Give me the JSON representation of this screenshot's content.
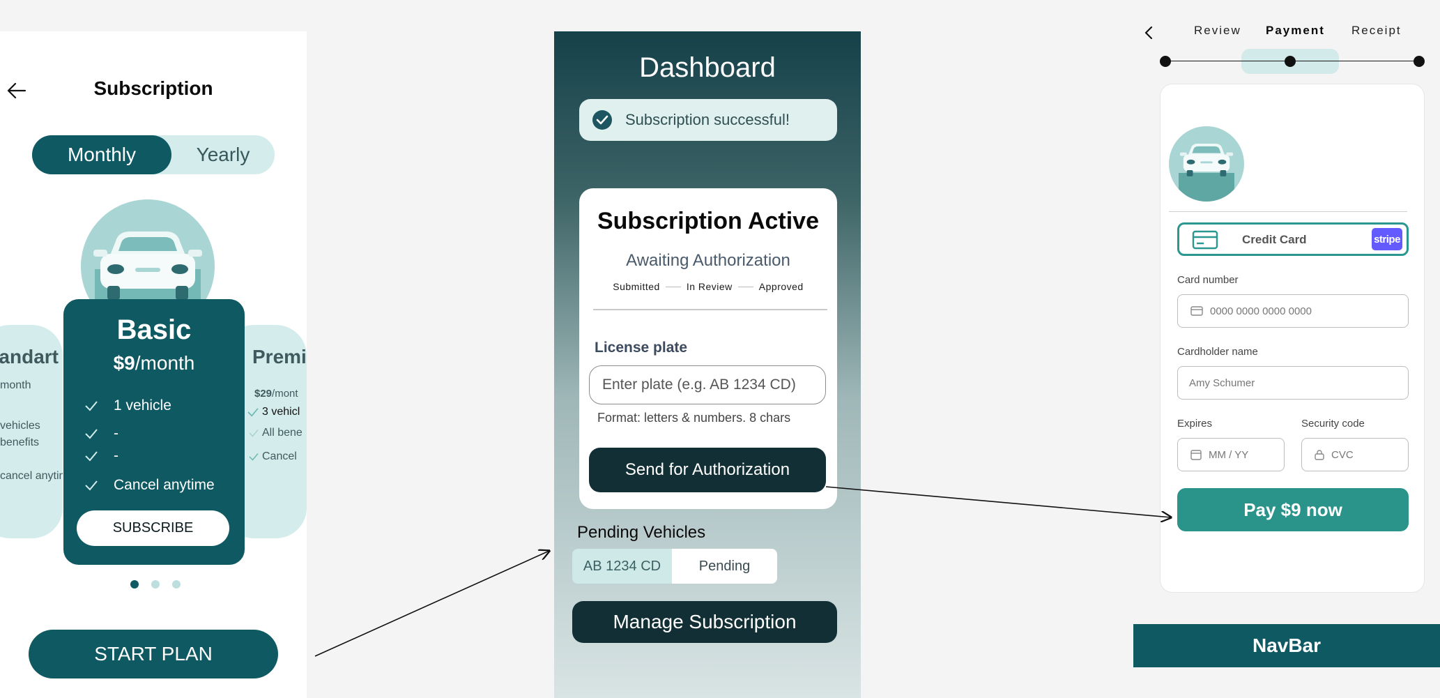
{
  "subscription_screen": {
    "title": "Subscription",
    "toggle": {
      "monthly": "Monthly",
      "yearly": "Yearly"
    },
    "plans": [
      {
        "name": "Standart",
        "price": "",
        "period": "month",
        "features": [
          "vehicles",
          "benefits",
          "cancel anytime"
        ]
      },
      {
        "name": "Basic",
        "price": "$9",
        "period": "/month",
        "features": [
          "1 vehicle",
          "-",
          "-",
          "Cancel anytime"
        ],
        "cta": "SUBSCRIBE"
      },
      {
        "name": "Premi",
        "price": "$29",
        "period": "/mont",
        "features": [
          "3 vehicl",
          "All bene",
          "Cancel"
        ]
      }
    ],
    "carousel": {
      "pages": 3,
      "active_index": 0
    },
    "start_plan": "START PLAN"
  },
  "dashboard_screen": {
    "title": "Dashboard",
    "toast": "Subscription successful!",
    "status_card": {
      "title": "Subscription Active",
      "subtitle": "Awaiting Authorization",
      "steps": [
        "Submitted",
        "In Review",
        "Approved"
      ],
      "plate_label": "License plate",
      "plate_placeholder": "Enter plate (e.g. AB 1234 CD)",
      "plate_hint": "Format: letters & numbers. 8 chars",
      "send_button": "Send for Authorization"
    },
    "pending": {
      "title": "Pending Vehicles",
      "items": [
        {
          "plate": "AB 1234 CD",
          "status": "Pending"
        }
      ]
    },
    "manage_button": "Manage Subscription"
  },
  "payment_screen": {
    "tabs": [
      "Review",
      "Payment",
      "Receipt"
    ],
    "active_tab": "Payment",
    "stepper": {
      "steps": 3,
      "current": 2
    },
    "method": {
      "label": "Credit Card",
      "provider": "stripe"
    },
    "fields": {
      "card_number": {
        "label": "Card number",
        "placeholder": "0000 0000 0000 0000"
      },
      "cardholder": {
        "label": "Cardholder name",
        "placeholder": "Amy Schumer"
      },
      "expires": {
        "label": "Expires",
        "placeholder": "MM / YY"
      },
      "security": {
        "label": "Security code",
        "placeholder": "CVC"
      }
    },
    "pay_button": "Pay $9 now",
    "navbar": "NavBar"
  },
  "colors": {
    "primary_teal": "#0f5962",
    "light_teal": "#d4ecec",
    "dark_button": "#122f35",
    "pay_green": "#2a948b",
    "stripe_purple": "#635bff"
  },
  "icons": [
    "back-arrow-icon",
    "check-icon",
    "check-circle-icon",
    "car-icon",
    "credit-card-icon",
    "calendar-icon",
    "lock-icon",
    "chevron-left-icon"
  ]
}
